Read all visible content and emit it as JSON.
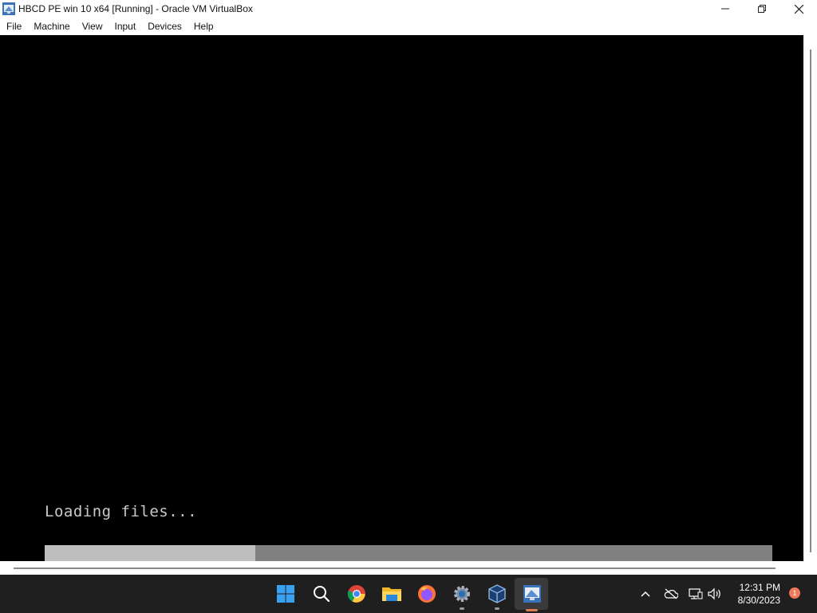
{
  "window": {
    "title": "HBCD PE win 10 x64 [Running] - Oracle VM VirtualBox",
    "icon": "virtualbox-vm-icon"
  },
  "menu": [
    "File",
    "Machine",
    "View",
    "Input",
    "Devices",
    "Help"
  ],
  "vm": {
    "loading_text": "Loading files...",
    "progress_fraction": 0.29
  },
  "taskbar": {
    "icons": [
      "windows-start-icon",
      "search-icon",
      "chrome-icon",
      "file-explorer-icon",
      "firefox-icon",
      "settings-icon",
      "virtualbox-manager-icon",
      "virtualbox-vm-icon"
    ],
    "tray_icons": [
      "chevron-up-icon",
      "onedrive-icon",
      "network-icon",
      "volume-icon"
    ],
    "time": "12:31 PM",
    "date": "8/30/2023",
    "notification_count": "1"
  },
  "colors": {
    "vm_background": "#000000",
    "progress_track": "#808080",
    "progress_fill": "#bebebe",
    "taskbar": "#1f1f1f",
    "active_indicator": "#d97c4f"
  }
}
